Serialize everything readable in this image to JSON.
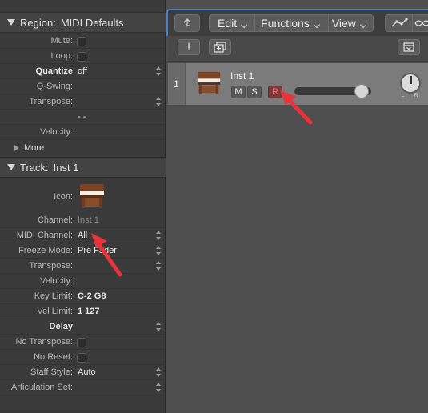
{
  "region": {
    "header_label": "Region:",
    "header_name": "MIDI Defaults",
    "rows": [
      {
        "label": "Mute:",
        "type": "checkbox"
      },
      {
        "label": "Loop:",
        "type": "checkbox"
      },
      {
        "label": "Quantize",
        "value": "off",
        "bold_label": true,
        "updown": true
      },
      {
        "label": "Q-Swing:",
        "value": ""
      },
      {
        "label": "Transpose:",
        "value": "",
        "updown": true
      },
      {
        "label": "",
        "value": "-  -"
      },
      {
        "label": "Velocity:",
        "value": ""
      }
    ],
    "more_label": "More"
  },
  "track": {
    "header_label": "Track:",
    "header_name": "Inst 1",
    "icon_label": "Icon:",
    "rows": [
      {
        "label": "Channel:",
        "value": "Inst 1",
        "dim": true
      },
      {
        "label": "MIDI Channel:",
        "value": "All",
        "updown": true
      },
      {
        "label": "Freeze Mode:",
        "value": "Pre Fader",
        "updown": true
      },
      {
        "label": "Transpose:",
        "value": "",
        "updown": true
      },
      {
        "label": "Velocity:",
        "value": ""
      },
      {
        "label": "Key Limit:",
        "value": "C-2  G8",
        "bold": true
      },
      {
        "label": "Vel Limit:",
        "value": "1  127",
        "bold": true
      },
      {
        "label": "Delay",
        "value": "",
        "bold_label": true,
        "updown": true
      },
      {
        "label": "No Transpose:",
        "type": "checkbox"
      },
      {
        "label": "No Reset:",
        "type": "checkbox"
      },
      {
        "label": "Staff Style:",
        "value": "Auto",
        "updown": true
      },
      {
        "label": "Articulation Set:",
        "value": "",
        "updown": true
      }
    ]
  },
  "toolbar": {
    "edit_label": "Edit",
    "functions_label": "Functions",
    "view_label": "View"
  },
  "tracks": [
    {
      "number": "1",
      "name": "Inst 1",
      "mute": "M",
      "solo": "S",
      "record": "R",
      "pan_left": "L",
      "pan_right": "R"
    }
  ],
  "colors": {
    "accent_focus": "#4b7fc9",
    "record_red": "#ff6a6a",
    "annotation_arrow": "#e8333a"
  }
}
